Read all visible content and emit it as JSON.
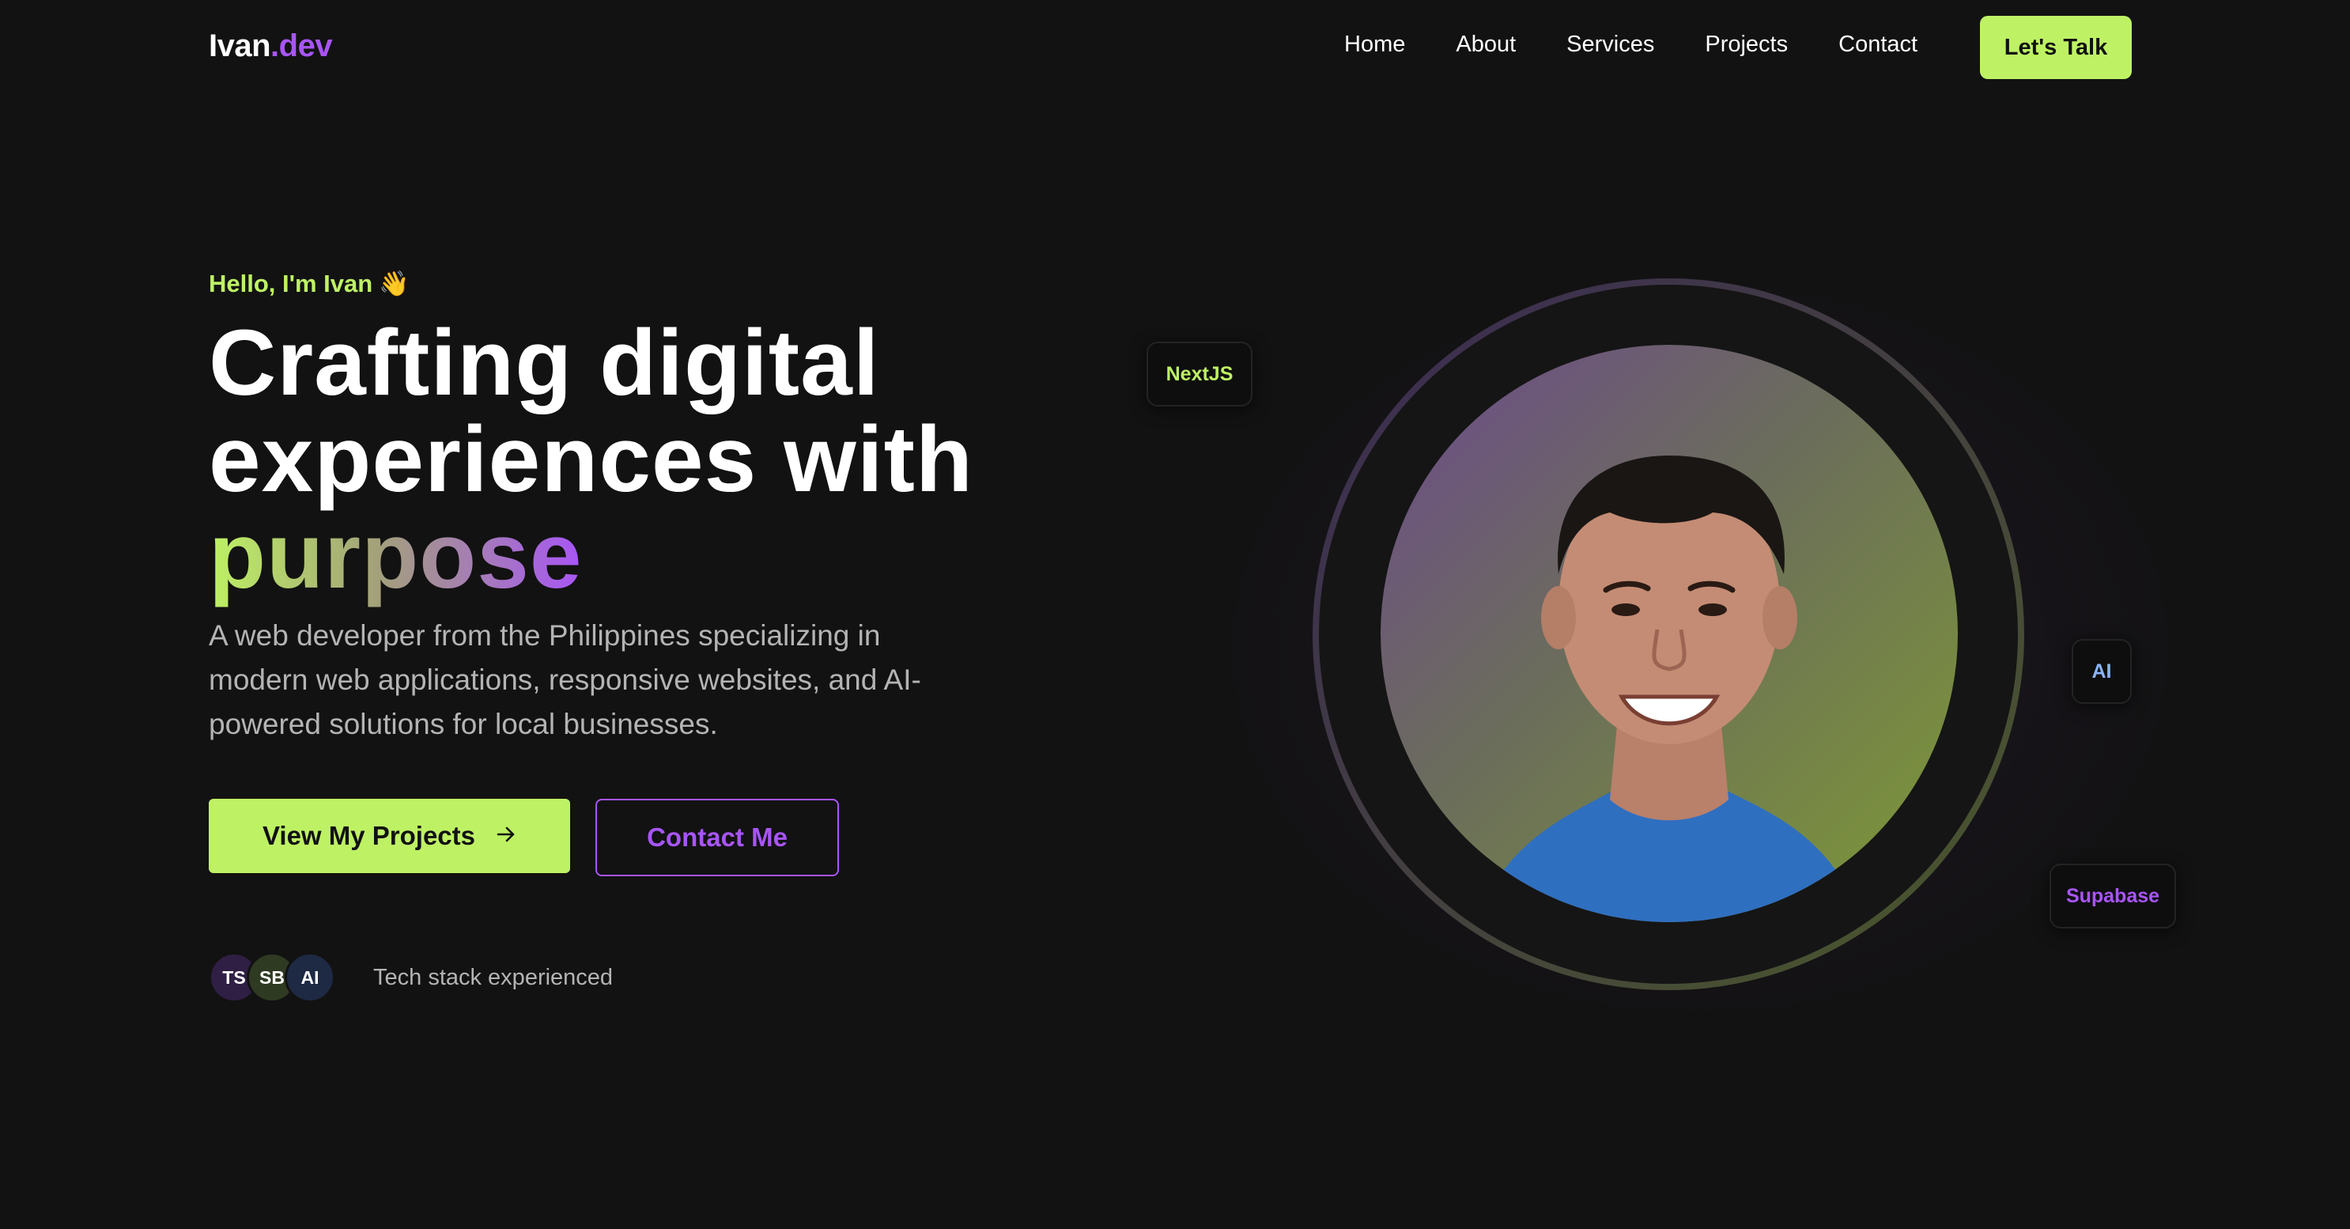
{
  "nav": {
    "logo_name": "Ivan",
    "logo_suffix": ".dev",
    "links": [
      "Home",
      "About",
      "Services",
      "Projects",
      "Contact"
    ],
    "cta": "Let's Talk"
  },
  "hero": {
    "greeting": "Hello, I'm Ivan",
    "greeting_emoji": "👋",
    "headline_line1": "Crafting digital",
    "headline_line2": "experiences with",
    "headline_highlight": "purpose",
    "subtext": "A web developer from the Philippines specializing in modern web applications, responsive websites, and AI-powered solutions for local businesses.",
    "primary_button": "View My Projects",
    "primary_button_icon": "arrow-right-icon",
    "secondary_button": "Contact Me",
    "stack_chips": [
      "TS",
      "SB",
      "AI"
    ],
    "stack_label": "Tech stack experienced"
  },
  "badges": {
    "nextjs": "NextJS",
    "ai": "AI",
    "supabase": "Supabase"
  },
  "colors": {
    "accent_green": "#bef264",
    "accent_purple": "#a855f7",
    "background": "#121212"
  }
}
